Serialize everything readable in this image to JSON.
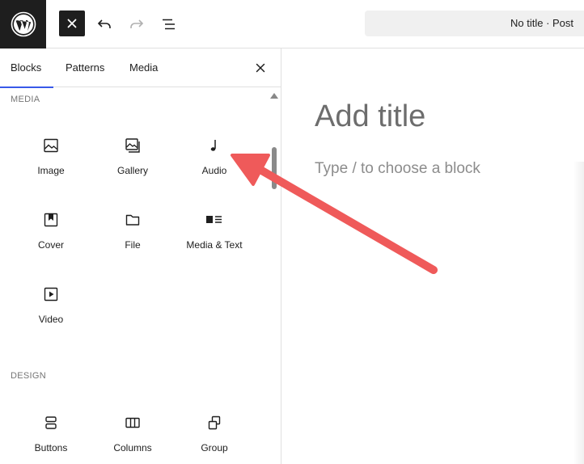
{
  "toolbar": {
    "document_title": "No title · Post"
  },
  "sidebar": {
    "tabs": [
      {
        "label": "Blocks",
        "active": true
      },
      {
        "label": "Patterns",
        "active": false
      },
      {
        "label": "Media",
        "active": false
      }
    ],
    "categories": {
      "media": {
        "title": "MEDIA",
        "blocks": [
          {
            "label": "Image",
            "icon": "image-icon"
          },
          {
            "label": "Gallery",
            "icon": "gallery-icon"
          },
          {
            "label": "Audio",
            "icon": "audio-icon"
          },
          {
            "label": "Cover",
            "icon": "cover-icon"
          },
          {
            "label": "File",
            "icon": "file-icon"
          },
          {
            "label": "Media & Text",
            "icon": "media-text-icon"
          },
          {
            "label": "Video",
            "icon": "video-icon"
          }
        ]
      },
      "design": {
        "title": "DESIGN",
        "blocks": [
          {
            "label": "Buttons",
            "icon": "buttons-icon"
          },
          {
            "label": "Columns",
            "icon": "columns-icon"
          },
          {
            "label": "Group",
            "icon": "group-icon"
          }
        ]
      }
    }
  },
  "editor": {
    "title_placeholder": "Add title",
    "block_placeholder": "Type / to choose a block"
  },
  "colors": {
    "dark": "#1e1e1e",
    "accent": "#3858e9",
    "annotation_arrow": "#ef5a5a"
  }
}
